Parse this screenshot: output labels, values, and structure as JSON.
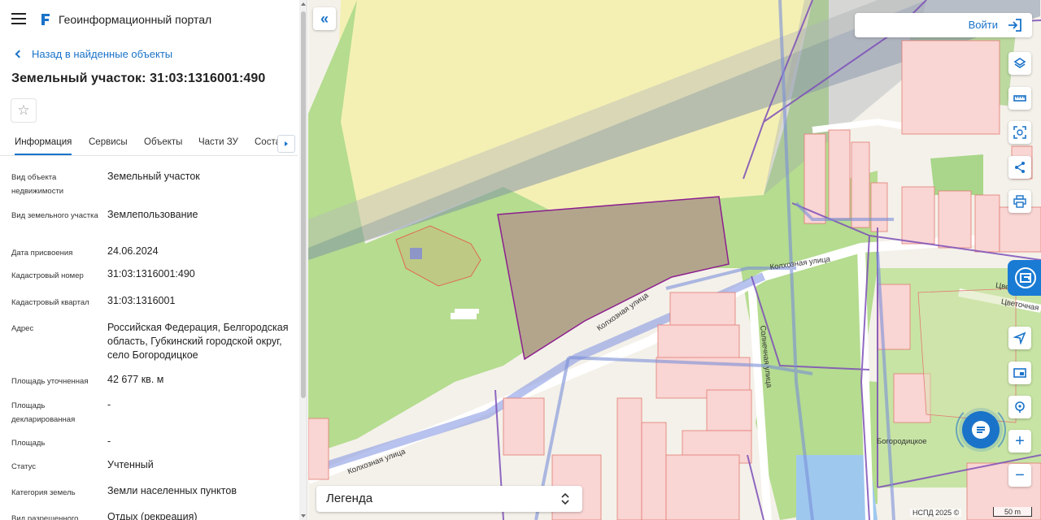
{
  "header": {
    "app_title": "Геоинформационный портал",
    "menu_icon": "hamburger-menu-icon",
    "logo_icon": "portal-logo-icon"
  },
  "object": {
    "back_label": "Назад в найденные объекты",
    "title": "Земельный участок: 31:03:1316001:490"
  },
  "tabs": [
    {
      "label": "Информация",
      "active": true
    },
    {
      "label": "Сервисы",
      "active": false
    },
    {
      "label": "Объекты",
      "active": false
    },
    {
      "label": "Части ЗУ",
      "active": false
    },
    {
      "label": "Состав",
      "active": false
    }
  ],
  "properties": [
    {
      "key": "Вид объекта недвижимости",
      "value": "Земельный участок"
    },
    {
      "key": "Вид земельного участка",
      "value": "Землепользование"
    },
    {
      "key": "Дата присвоения",
      "value": "24.06.2024"
    },
    {
      "key": "Кадастровый номер",
      "value": "31:03:1316001:490"
    },
    {
      "key": "Кадастровый квартал",
      "value": "31:03:1316001"
    },
    {
      "key": "Адрес",
      "value": "Российская Федерация, Белгородская область, Губкинский городской округ, село Богородицкое"
    },
    {
      "key": "Площадь уточненная",
      "value": "42 677 кв. м"
    },
    {
      "key": "Площадь декларированная",
      "value": "-"
    },
    {
      "key": "Площадь",
      "value": "-"
    },
    {
      "key": "Статус",
      "value": "Учтенный"
    },
    {
      "key": "Категория земель",
      "value": "Земли населенных пунктов"
    },
    {
      "key": "Вид разрешенного",
      "value": "Отдых (рекреация)"
    }
  ],
  "map": {
    "login_label": "Войти",
    "legend_label": "Легенда",
    "attribution": "НСПД 2025 ©",
    "scale_label": "50 m",
    "street_labels": [
      {
        "text": "Колхозная улица",
        "id": "kolkhoznaya-1"
      },
      {
        "text": "Колхозная улица",
        "id": "kolkhoznaya-2"
      },
      {
        "text": "Колхозная улица",
        "id": "kolkhoznaya-3"
      },
      {
        "text": "Солнечная улица",
        "id": "solnechnaya"
      },
      {
        "text": "Цветочная",
        "id": "tsvetochnaya"
      },
      {
        "text": "Цве",
        "id": "tsvetochnaya-short"
      },
      {
        "text": "Богородицкое",
        "id": "bogoroditskoe"
      }
    ],
    "colors": {
      "parcel_fill": "#b3a58c",
      "parcel_stroke": "#8d1f8f",
      "green_area": "#b5dc8f",
      "yellow_area": "#f4f0b4",
      "building_fill": "#f9d5d3",
      "building_stroke": "#e27b74",
      "boundary": "#7d4fb8",
      "accent": "#1a73c9"
    }
  }
}
